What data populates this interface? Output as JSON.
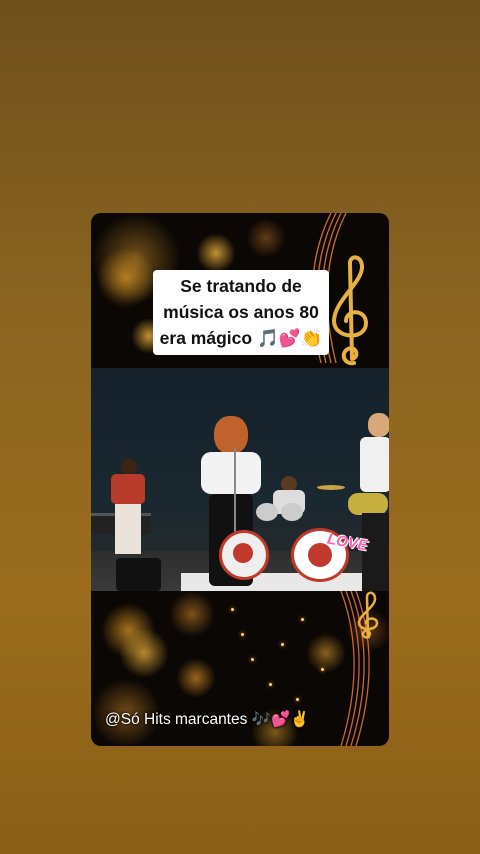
{
  "caption": {
    "line1": "Se tratando de",
    "line2": "música os anos 80",
    "line3": "era mágico 🎵💕👏"
  },
  "sticker": "LOVE",
  "watermark": "@Só Hits marcantes 🎶💕✌️",
  "icons": [
    "treble-clef-icon",
    "music-staff-icon"
  ],
  "colors": {
    "background": "#8a6420",
    "card": "#0b0704",
    "accent_gold": "#e3a43a"
  }
}
